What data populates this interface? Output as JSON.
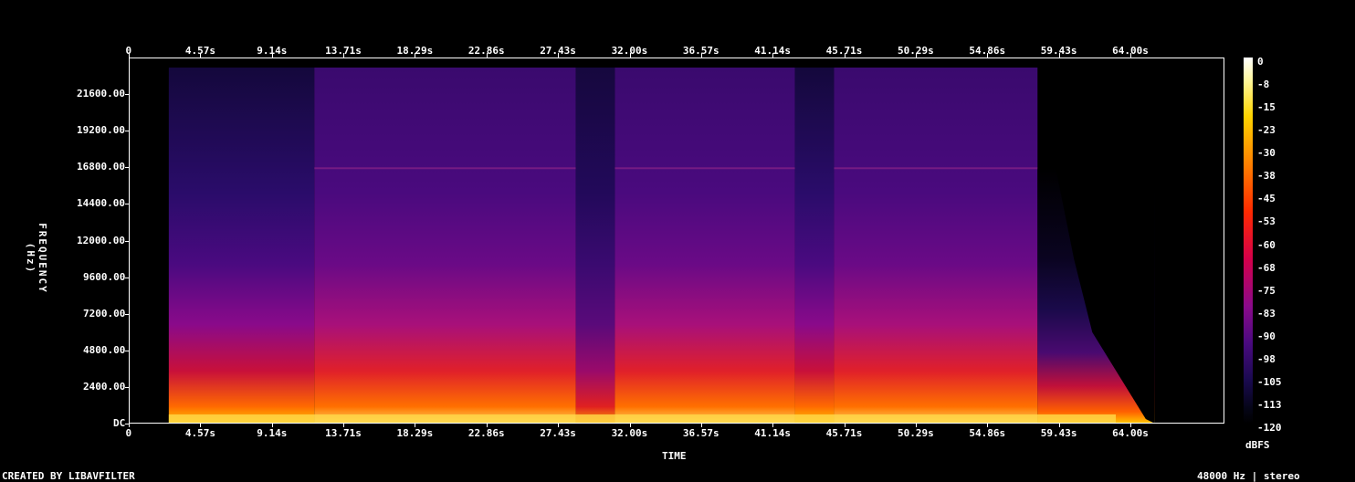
{
  "chart_data": {
    "type": "heatmap",
    "title": "",
    "xlabel": "TIME",
    "ylabel": "FREQUENCY (Hz)",
    "x_ticks_top": [
      "0",
      "4.57s",
      "9.14s",
      "13.71s",
      "18.29s",
      "22.86s",
      "27.43s",
      "32.00s",
      "36.57s",
      "41.14s",
      "45.71s",
      "50.29s",
      "54.86s",
      "59.43s",
      "64.00s"
    ],
    "x_ticks_bottom": [
      "0",
      "4.57s",
      "9.14s",
      "13.71s",
      "18.29s",
      "22.86s",
      "27.43s",
      "32.00s",
      "36.57s",
      "41.14s",
      "45.71s",
      "50.29s",
      "54.86s",
      "59.43s",
      "64.00s"
    ],
    "y_ticks": [
      "21600.00",
      "19200.00",
      "16800.00",
      "14400.00",
      "12000.00",
      "9600.00",
      "7200.00",
      "4800.00",
      "2400.00",
      "DC"
    ],
    "colorbar_label": "dBFS",
    "colorbar_ticks": [
      "0",
      "-8",
      "-15",
      "-23",
      "-30",
      "-38",
      "-45",
      "-53",
      "-60",
      "-68",
      "-75",
      "-83",
      "-90",
      "-98",
      "-105",
      "-113",
      "-120"
    ],
    "xlim": [
      0,
      70
    ],
    "ylim": [
      0,
      24000
    ],
    "segments": [
      {
        "start": 2.5,
        "end": 11.8,
        "level": "low"
      },
      {
        "start": 11.8,
        "end": 28.5,
        "level": "high"
      },
      {
        "start": 28.5,
        "end": 31.0,
        "level": "mid"
      },
      {
        "start": 31.0,
        "end": 42.5,
        "level": "high"
      },
      {
        "start": 42.5,
        "end": 45.0,
        "level": "low"
      },
      {
        "start": 45.0,
        "end": 58.0,
        "level": "high"
      },
      {
        "start": 58.0,
        "end": 65.5,
        "level": "fade"
      }
    ]
  },
  "footer": {
    "left": "CREATED BY LIBAVFILTER",
    "right": "48000 Hz | stereo"
  }
}
